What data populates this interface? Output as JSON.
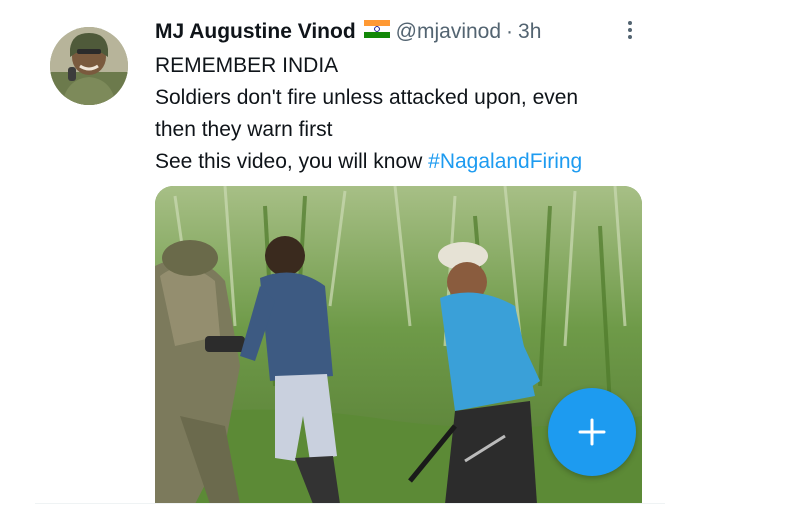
{
  "tweet": {
    "display_name": "MJ Augustine Vinod",
    "flag_icon": "india-flag-icon",
    "handle": "@mjavinod",
    "separator": "·",
    "time": "3h",
    "lines": [
      "REMEMBER INDIA",
      "Soldiers don't fire unless attacked upon, even",
      "then they warn first",
      "See this video, you will know "
    ],
    "hashtag": "#NagalandFiring",
    "media_alt_icon": "video-thumbnail",
    "fab_icon": "plus-icon",
    "more_icon": "vertical-ellipsis-icon"
  },
  "colors": {
    "accent": "#1d9bf0",
    "secondary_text": "#536471",
    "primary_text": "#0f1419"
  }
}
